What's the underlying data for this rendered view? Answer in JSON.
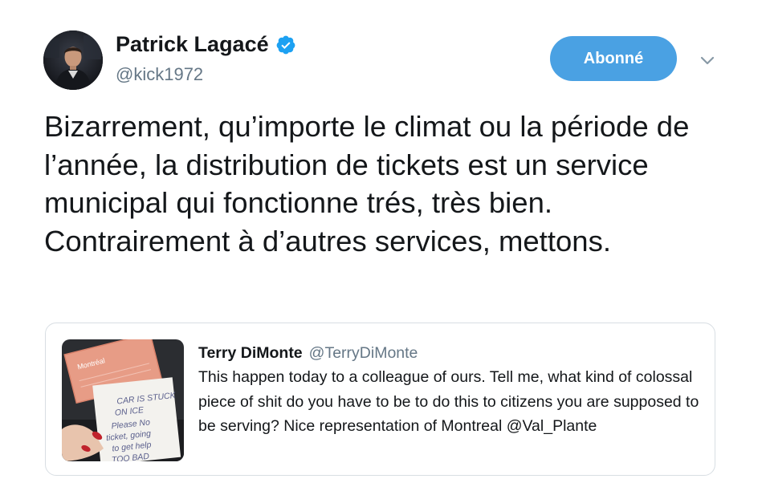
{
  "author": {
    "display_name": "Patrick Lagacé",
    "handle": "@kick1972",
    "verified": true,
    "avatar_icon": "profile-photo"
  },
  "follow_button": {
    "label": "Abonné"
  },
  "menu": {
    "icon": "chevron-down-icon"
  },
  "tweet": {
    "text": "Bizarrement, qu’importe le climat ou la période de l’année, la distribution de tickets est un service municipal qui fonctionne trés, très bien. Contrairement à d’autres services, mettons."
  },
  "quoted_tweet": {
    "display_name": "Terry DiMonte",
    "handle": "@TerryDiMonte",
    "text": "This happen today to a colleague of ours. Tell me, what kind of colossal piece of shit do you have to be to do this to citizens you are supposed to be serving? Nice representation of Montreal @Val_Plante",
    "image": {
      "envelope_label": "Montréal",
      "note_lines": [
        "CAR IS STUCK",
        "ON ICE",
        "Please No",
        "ticket, going",
        "to get help",
        "TOO BAD"
      ]
    }
  },
  "colors": {
    "accent": "#4aa1e3",
    "secondary_text": "#657786",
    "primary_text": "#14171a",
    "border": "#d8dee3"
  }
}
